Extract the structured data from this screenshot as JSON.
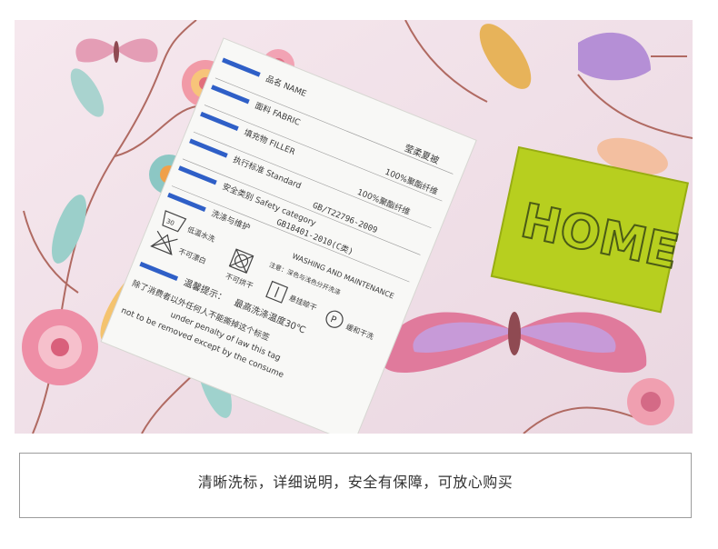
{
  "photo": {
    "label": {
      "rows": [
        {
          "en": "NAME",
          "zh": "品名",
          "value": "莹柔夏被"
        },
        {
          "en": "FABRIC",
          "zh": "面料",
          "value": "100%聚酯纤维"
        },
        {
          "en": "FILLER",
          "zh": "填充物",
          "value": "100%聚酯纤维"
        },
        {
          "en": "Standard",
          "zh": "执行标准",
          "value": "GB/T22796-2009"
        },
        {
          "en": "Safety category",
          "zh": "安全类别",
          "value": "GB18401-2010(C类)"
        },
        {
          "en": "WASHING AND MAINTENANCE",
          "zh": "洗涤与维护",
          "value": ""
        }
      ],
      "care": [
        {
          "icon": "wash-30-icon",
          "text": "低温水洗"
        },
        {
          "icon": "no-bleach-icon",
          "text": "不可漂白"
        },
        {
          "icon": "no-tumble-dry-icon",
          "text": "不可烘干"
        },
        {
          "icon": "hang-dry-icon",
          "text": "悬挂晾干"
        },
        {
          "icon": "dry-clean-p-icon",
          "text": "缓和干洗"
        }
      ],
      "care_note": "注意：深色与浅色分开洗涤",
      "tip_title": "温馨提示：",
      "tip_text": "最高洗涤温度30℃",
      "legal_zh": "除了消费者以外任何人不能撕掉这个标签",
      "legal_en_1": "under penalty of law this tag",
      "legal_en_2": "not to be removed except by the consume"
    },
    "brand_tag": "HOME",
    "brand_color": "#b7cf1f"
  },
  "caption": "清晰洗标，详细说明，安全有保障，可放心购买"
}
